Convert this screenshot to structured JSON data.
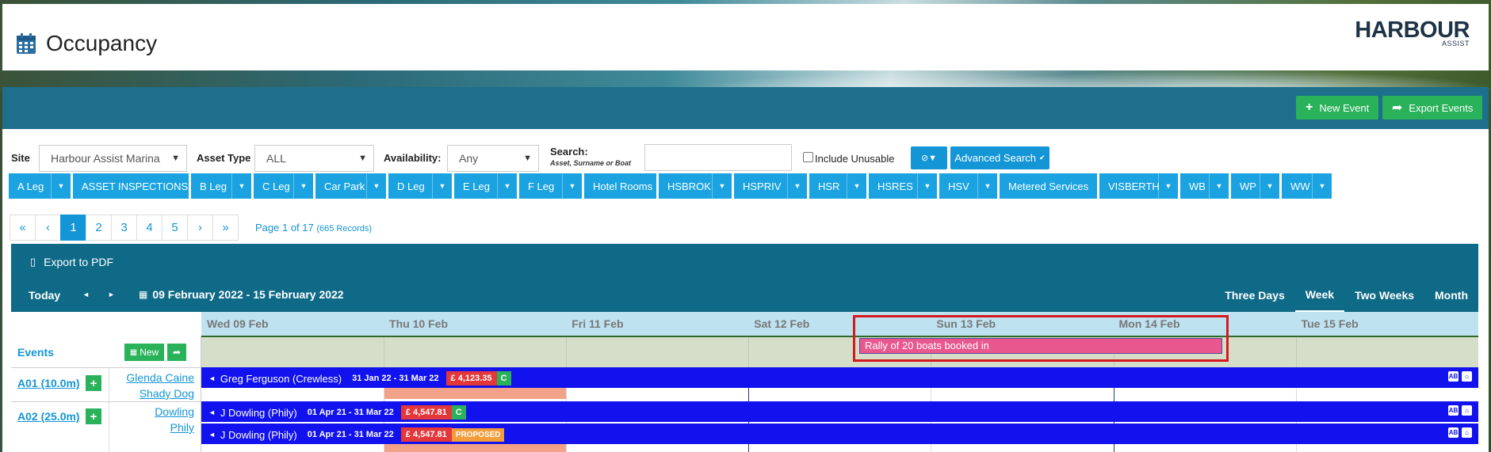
{
  "header": {
    "title": "Occupancy",
    "logo_main": "HARBOUR",
    "logo_sub": "ASSIST"
  },
  "toolbar": {
    "new_event": "New Event",
    "export_events": "Export Events"
  },
  "filters": {
    "site_label": "Site",
    "site_value": "Harbour Assist Marina",
    "asset_type_label": "Asset Type",
    "asset_type_value": "ALL",
    "availability_label": "Availability:",
    "availability_value": "Any",
    "search_label": "Search:",
    "search_hint": "Asset, Surname or Boat",
    "search_value": "",
    "include_unusable_label": "Include Unusable",
    "advanced_search": "Advanced Search"
  },
  "asset_tags": [
    {
      "label": "A Leg",
      "dropdown": true
    },
    {
      "label": "ASSET INSPECTIONS",
      "dropdown": false
    },
    {
      "label": "B Leg",
      "dropdown": true
    },
    {
      "label": "C Leg",
      "dropdown": true
    },
    {
      "label": "Car Park",
      "dropdown": true
    },
    {
      "label": "D Leg",
      "dropdown": true
    },
    {
      "label": "E Leg",
      "dropdown": true
    },
    {
      "label": "F Leg",
      "dropdown": true
    },
    {
      "label": "Hotel Rooms",
      "dropdown": false
    },
    {
      "label": "HSBROK",
      "dropdown": true
    },
    {
      "label": "HSPRIV",
      "dropdown": true
    },
    {
      "label": "HSR",
      "dropdown": true
    },
    {
      "label": "HSRES",
      "dropdown": true
    },
    {
      "label": "HSV",
      "dropdown": true
    },
    {
      "label": "Metered Services",
      "dropdown": false
    },
    {
      "label": "VISBERTH",
      "dropdown": true
    },
    {
      "label": "WB",
      "dropdown": true
    },
    {
      "label": "WP",
      "dropdown": true
    },
    {
      "label": "WW",
      "dropdown": true
    }
  ],
  "pagination": {
    "first": "«",
    "prev": "‹",
    "pages": [
      "1",
      "2",
      "3",
      "4",
      "5"
    ],
    "current": "1",
    "next": "›",
    "last": "»",
    "info": "Page 1 of 17",
    "records": "(665 Records)"
  },
  "calendar": {
    "export_pdf": "Export to PDF",
    "today": "Today",
    "prev": "◄",
    "next": "►",
    "date_range": "09 February 2022 - 15 February 2022",
    "views": [
      "Three Days",
      "Week",
      "Two Weeks",
      "Month"
    ],
    "active_view": "Week",
    "days": [
      "Wed 09 Feb",
      "Thu 10 Feb",
      "Fri 11 Feb",
      "Sat 12 Feb",
      "Sun 13 Feb",
      "Mon 14 Feb",
      "Tue 15 Feb"
    ],
    "events_label": "Events",
    "events_new": "New",
    "event_banner": "Rally of 20 boats booked in"
  },
  "rows": [
    {
      "asset": "A01 (10.0m)",
      "owner_line1": "Glenda Caine",
      "owner_line2": "Shady Dog",
      "bookings": [
        {
          "name": "Greg Ferguson (Crewless)",
          "dates": "31 Jan 22 - 31 Mar 22",
          "price": "£ 4,123.35",
          "status": "C"
        }
      ]
    },
    {
      "asset": "A02 (25.0m)",
      "owner_line1": "Dowling",
      "owner_line2": "Phily",
      "bookings": [
        {
          "name": "J Dowling (Phily)",
          "dates": "01 Apr 21 - 31 Mar 22",
          "price": "£ 4,547.81",
          "status": "C"
        },
        {
          "name": "J Dowling (Phily)",
          "dates": "01 Apr 21 - 31 Mar 22",
          "price": "£ 4,547.81",
          "status": "PROPOSED"
        }
      ]
    }
  ],
  "colors": {
    "teal": "#1e6f8b",
    "green": "#2ab25a",
    "blue": "#1395d6",
    "booking_blue": "#1212ee",
    "event_pink": "#e8588f",
    "highlight_red": "#d4191f"
  }
}
